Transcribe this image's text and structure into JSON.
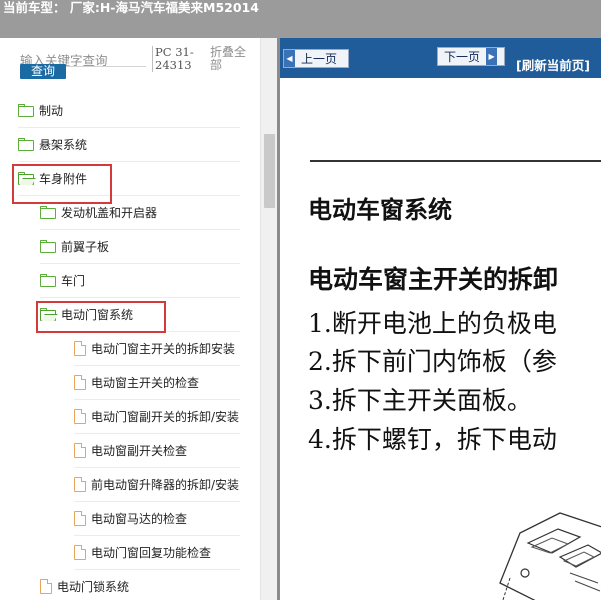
{
  "header": {
    "vehicle_label": "当前车型： 厂家:H-海马汽车福美来M52014"
  },
  "sidebar": {
    "search_placeholder": "输入关键字查询",
    "query_label": "查询",
    "pc_code": "PC 31-24313",
    "collapse_label": "折叠全部",
    "items": [
      {
        "label": "制动",
        "type": "folder",
        "level": 0
      },
      {
        "label": "悬架系统",
        "type": "folder",
        "level": 0
      },
      {
        "label": "车身附件",
        "type": "folder-open",
        "level": 0
      },
      {
        "label": "发动机盖和开启器",
        "type": "folder",
        "level": 1
      },
      {
        "label": "前翼子板",
        "type": "folder",
        "level": 1
      },
      {
        "label": "车门",
        "type": "folder",
        "level": 1
      },
      {
        "label": "电动门窗系统",
        "type": "folder-open",
        "level": 1
      },
      {
        "label": "电动门窗主开关的拆卸安装",
        "type": "doc",
        "level": 2
      },
      {
        "label": "电动窗主开关的检查",
        "type": "doc",
        "level": 2
      },
      {
        "label": "电动门窗副开关的拆卸/安装",
        "type": "doc",
        "level": 2
      },
      {
        "label": "电动窗副开关检查",
        "type": "doc",
        "level": 2
      },
      {
        "label": "前电动窗升降器的拆卸/安装",
        "type": "doc",
        "level": 2
      },
      {
        "label": "电动窗马达的检查",
        "type": "doc",
        "level": 2
      },
      {
        "label": "电动门窗回复功能检查",
        "type": "doc",
        "level": 2
      },
      {
        "label": "电动门锁系统",
        "type": "doc",
        "level": 1
      }
    ]
  },
  "viewer": {
    "prev_label": "上一页",
    "next_label": "下一页",
    "refresh_label": "[刷新当前页]",
    "title": "电动车窗系统",
    "subtitle": "电动车窗主开关的拆卸",
    "steps": [
      "1.断开电池上的负极电",
      "2.拆下前门内饰板（参",
      "3.拆下主开关面板。",
      "4.拆下螺钉，拆下电动"
    ]
  },
  "colors": {
    "topbar": "#9b9b9b",
    "viewer_header": "#1f5c99",
    "highlight": "#d43a3a",
    "folder": "#5cae3a",
    "doc_icon": "#e8a55a"
  }
}
